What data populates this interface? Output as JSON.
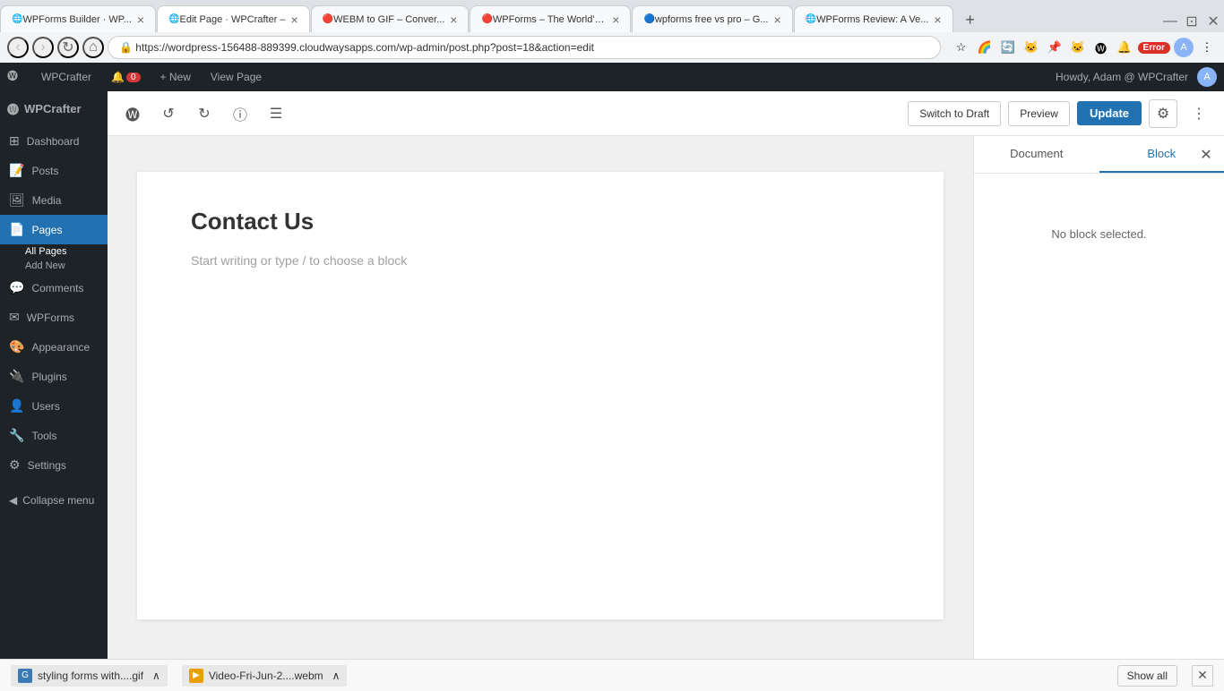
{
  "browser": {
    "address": "https://wordpress-156488-889399.cloudwaysapps.com/wp-admin/post.php?post=18&action=edit",
    "tabs": [
      {
        "id": "tab1",
        "title": "WPForms Builder · WP...",
        "active": false,
        "color": "#0073aa"
      },
      {
        "id": "tab2",
        "title": "Edit Page · WPCrafter –",
        "active": true,
        "color": "#0073aa"
      },
      {
        "id": "tab3",
        "title": "WEBM to GIF – Conver...",
        "active": false,
        "color": "#e74c3c"
      },
      {
        "id": "tab4",
        "title": "WPForms – The World'S...",
        "active": false,
        "color": "#e74c3c"
      },
      {
        "id": "tab5",
        "title": "wpforms free vs pro – G...",
        "active": false,
        "color": "#4285f4"
      },
      {
        "id": "tab6",
        "title": "WPForms Review: A Ve...",
        "active": false,
        "color": "#0073aa"
      }
    ],
    "controls": {
      "back": "‹",
      "forward": "›",
      "reload": "↻",
      "home": "⌂"
    },
    "error_label": "Error"
  },
  "admin_bar": {
    "site_name": "WPCrafter",
    "notification_count": "0",
    "new_label": "+ New",
    "view_page_label": "View Page",
    "howdy": "Howdy, Adam @ WPCrafter"
  },
  "sidebar": {
    "brand": "WPCrafter",
    "items": [
      {
        "label": "Dashboard",
        "icon": "⊞"
      },
      {
        "label": "Posts",
        "icon": "📝"
      },
      {
        "label": "Media",
        "icon": "🖼"
      },
      {
        "label": "Pages",
        "icon": "📄",
        "active": true,
        "sub": [
          "All Pages",
          "Add New"
        ]
      },
      {
        "label": "Comments",
        "icon": "💬"
      },
      {
        "label": "WPForms",
        "icon": "✉"
      },
      {
        "label": "Appearance",
        "icon": "🎨"
      },
      {
        "label": "Plugins",
        "icon": "🔌"
      },
      {
        "label": "Users",
        "icon": "👤"
      },
      {
        "label": "Tools",
        "icon": "🔧"
      },
      {
        "label": "Settings",
        "icon": "⚙"
      }
    ],
    "collapse_label": "Collapse menu"
  },
  "editor": {
    "toolbar": {
      "switch_draft_label": "Switch to Draft",
      "preview_label": "Preview",
      "update_label": "Update"
    },
    "canvas": {
      "page_title": "Contact Us",
      "placeholder": "Start writing or type / to choose a block"
    }
  },
  "right_panel": {
    "tabs": [
      "Document",
      "Block"
    ],
    "active_tab": "Block",
    "no_block_message": "No block selected."
  },
  "bottom_bar": {
    "file1_name": "styling forms with....gif",
    "file2_name": "Video-Fri-Jun-2....webm",
    "show_all_label": "Show all"
  }
}
